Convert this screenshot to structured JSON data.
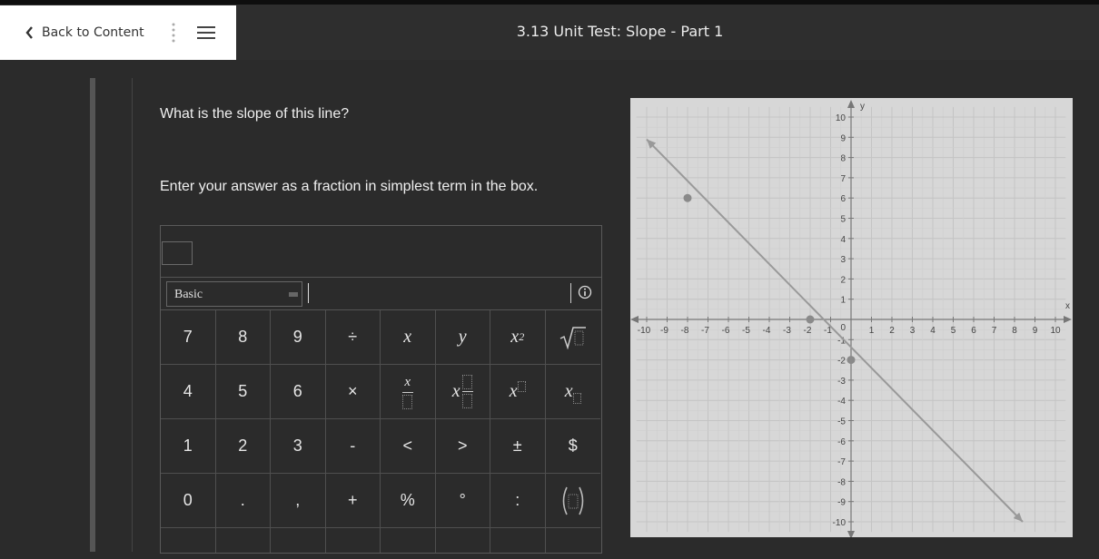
{
  "header": {
    "back_label": "Back to Content",
    "title": "3.13 Unit Test: Slope - Part 1"
  },
  "question": {
    "prompt": "What is the slope of this line?",
    "instruction": "Enter your answer as a fraction in simplest term in the box."
  },
  "editor": {
    "mode_label": "Basic",
    "keys_row1": [
      "7",
      "8",
      "9",
      "÷"
    ],
    "keys_row2": [
      "4",
      "5",
      "6",
      "×"
    ],
    "keys_row3": [
      "1",
      "2",
      "3",
      "-",
      "<",
      ">",
      "±",
      "$"
    ],
    "keys_row4": [
      "0",
      ".",
      ",",
      "+",
      "%",
      "°",
      ":"
    ],
    "var_x": "x",
    "var_y": "y",
    "sup_2": "2"
  },
  "graph": {
    "x_range": [
      -10,
      10
    ],
    "y_range": [
      -10,
      10
    ],
    "x_label": "x",
    "y_label": "y",
    "line_color": "#999999",
    "points": [
      [
        -8,
        6
      ],
      [
        -2,
        0
      ],
      [
        0,
        -2
      ]
    ],
    "line_start": [
      -10,
      8.9
    ],
    "line_end": [
      8.4,
      -10
    ]
  }
}
